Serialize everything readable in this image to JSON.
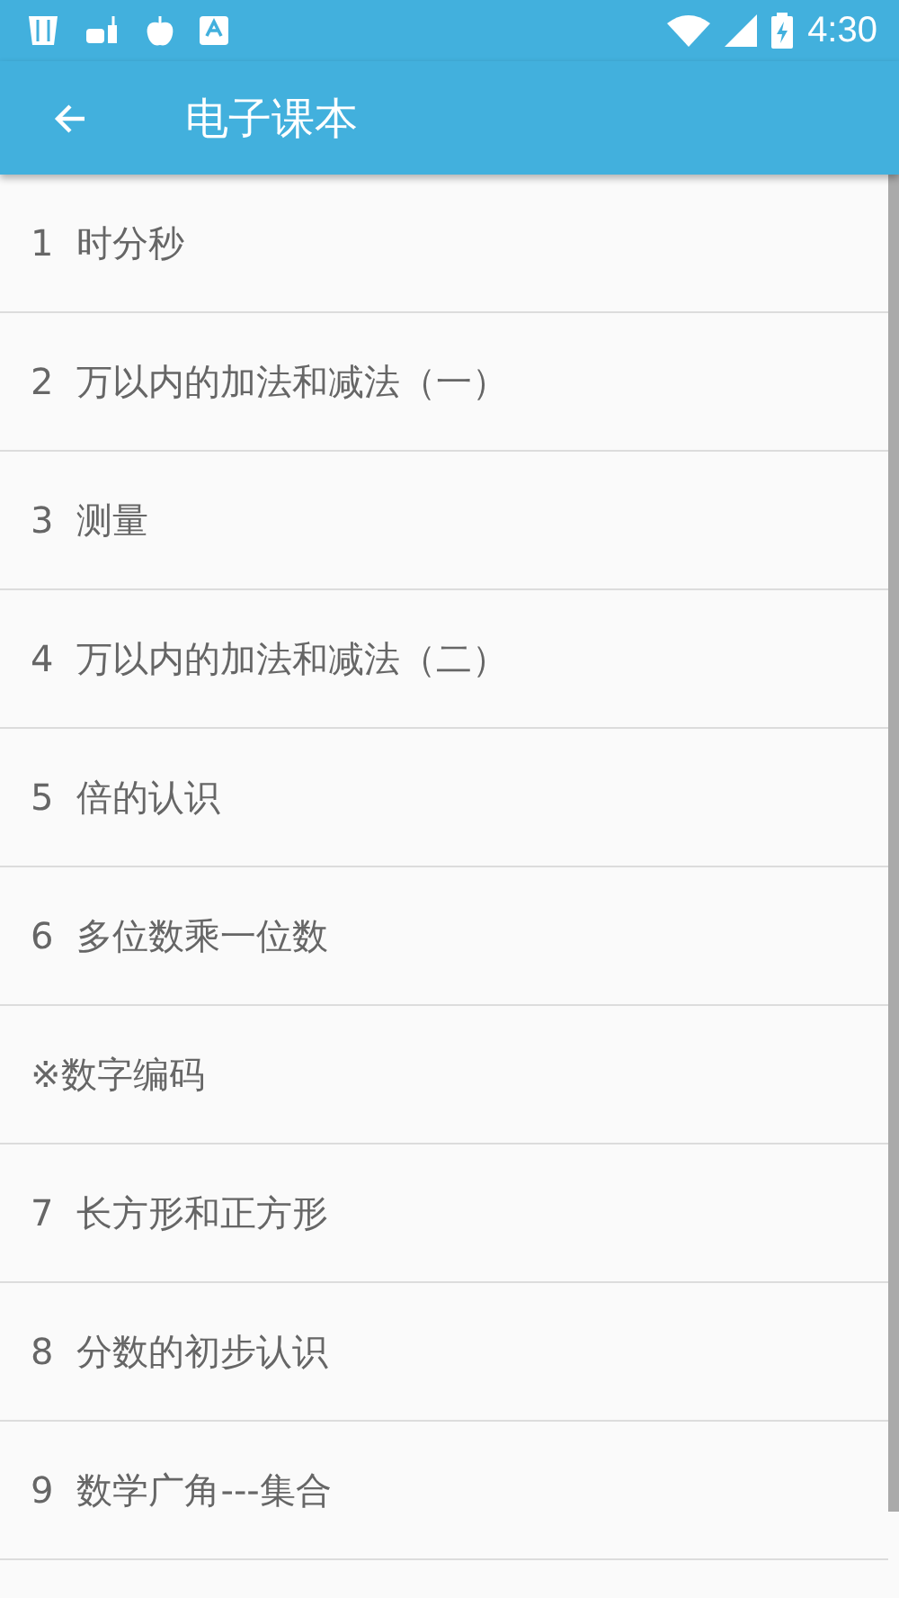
{
  "status_bar": {
    "time": "4:30"
  },
  "toolbar": {
    "title": "电子课本"
  },
  "chapters": [
    {
      "number": "1",
      "title": "时分秒"
    },
    {
      "number": "2",
      "title": "万以内的加法和减法（一）"
    },
    {
      "number": "3",
      "title": "测量"
    },
    {
      "number": "4",
      "title": "万以内的加法和减法（二）"
    },
    {
      "number": "5",
      "title": "倍的认识"
    },
    {
      "number": "6",
      "title": "多位数乘一位数"
    },
    {
      "title": "※数字编码"
    },
    {
      "number": "7",
      "title": "长方形和正方形"
    },
    {
      "number": "8",
      "title": "分数的初步认识"
    },
    {
      "number": "9",
      "title": "数学广角---集合"
    }
  ]
}
